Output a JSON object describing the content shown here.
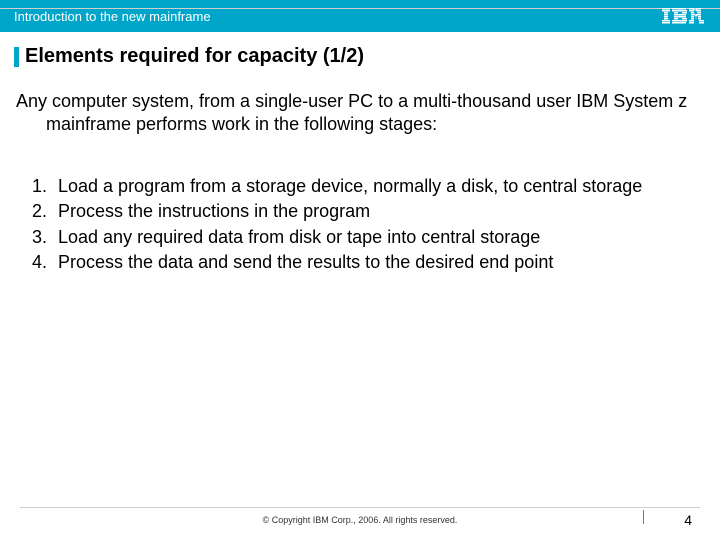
{
  "header": {
    "title": "Introduction to the new mainframe",
    "logo_alt": "IBM"
  },
  "slide": {
    "title": "Elements required for capacity (1/2)",
    "intro": "Any computer system, from a single-user PC to a multi-thousand user IBM System z mainframe performs work in the following stages:",
    "items": [
      {
        "num": "1.",
        "text": "Load a program from a storage device, normally a disk, to central storage"
      },
      {
        "num": "2.",
        "text": "Process the instructions in the program"
      },
      {
        "num": "3.",
        "text": "Load any required data from disk or tape into central storage"
      },
      {
        "num": "4.",
        "text": "Process the data and send the results to the desired end point"
      }
    ]
  },
  "footer": {
    "copyright": "© Copyright IBM Corp., 2006. All rights reserved.",
    "page": "4"
  }
}
